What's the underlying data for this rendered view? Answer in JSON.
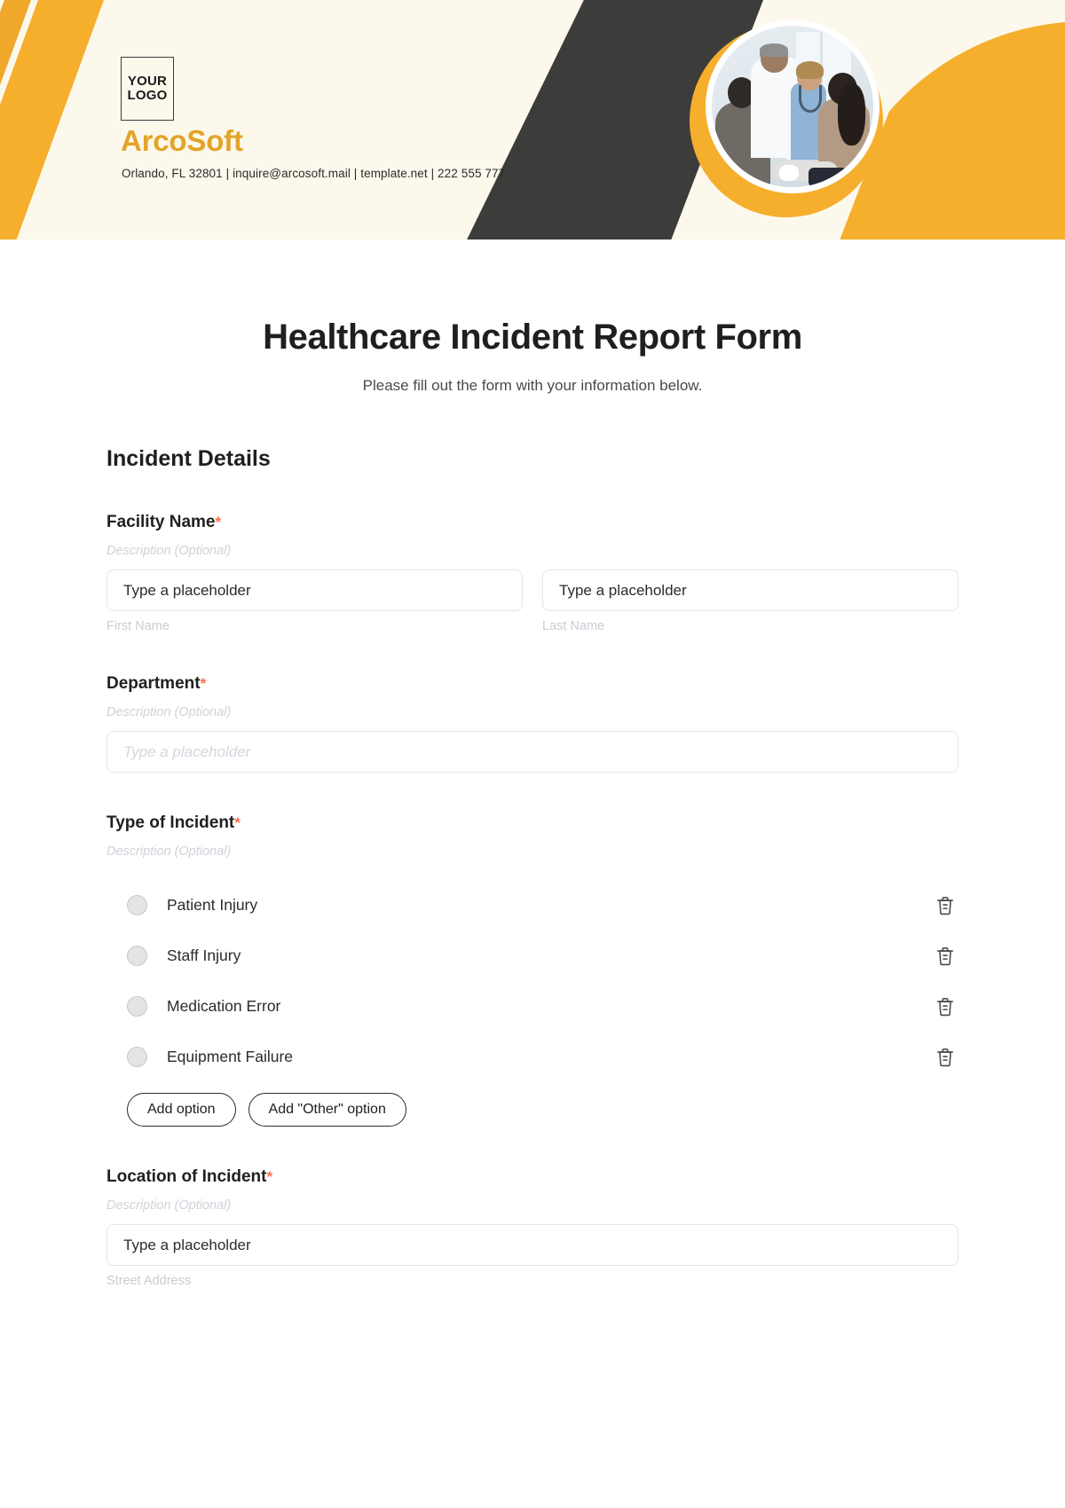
{
  "header": {
    "logo_line1": "YOUR",
    "logo_line2": "LOGO",
    "brand": "ArcoSoft",
    "contact": "Orlando, FL 32801 | inquire@arcosoft.mail | template.net | 222 555 777",
    "colors": {
      "background": "#FDF8EC",
      "orange": "#F5AF2C",
      "orange_dark": "#D99A22",
      "brand_text": "#E2A429",
      "dark": "#3C3C3B"
    }
  },
  "form": {
    "title": "Healthcare Incident Report Form",
    "subtitle": "Please fill out the form with your information below.",
    "section_title": "Incident Details",
    "required_marker": "*",
    "description_placeholder": "Description (Optional)",
    "fields": [
      {
        "label": "Facility Name",
        "required": true,
        "description": "Description (Optional)",
        "inputs": [
          {
            "placeholder": "Type a placeholder",
            "sub_label": "First Name",
            "muted": false
          },
          {
            "placeholder": "Type a placeholder",
            "sub_label": "Last Name",
            "muted": false
          }
        ]
      },
      {
        "label": "Department",
        "required": true,
        "description": "Description (Optional)",
        "inputs": [
          {
            "placeholder": "Type a placeholder",
            "sub_label": "",
            "muted": true
          }
        ]
      },
      {
        "label": "Type of Incident",
        "required": true,
        "description": "Description (Optional)",
        "options": [
          {
            "label": "Patient Injury",
            "delete_icon": "trash-icon"
          },
          {
            "label": "Staff Injury",
            "delete_icon": "trash-icon"
          },
          {
            "label": "Medication Error",
            "delete_icon": "trash-icon"
          },
          {
            "label": "Equipment Failure",
            "delete_icon": "trash-icon"
          }
        ],
        "buttons": [
          {
            "label": "Add option"
          },
          {
            "label": "Add \"Other\" option"
          }
        ]
      },
      {
        "label": "Location of Incident",
        "required": true,
        "description": "Description (Optional)",
        "inputs": [
          {
            "placeholder": "Type a placeholder",
            "sub_label": "Street Address",
            "muted": false
          }
        ]
      }
    ]
  }
}
